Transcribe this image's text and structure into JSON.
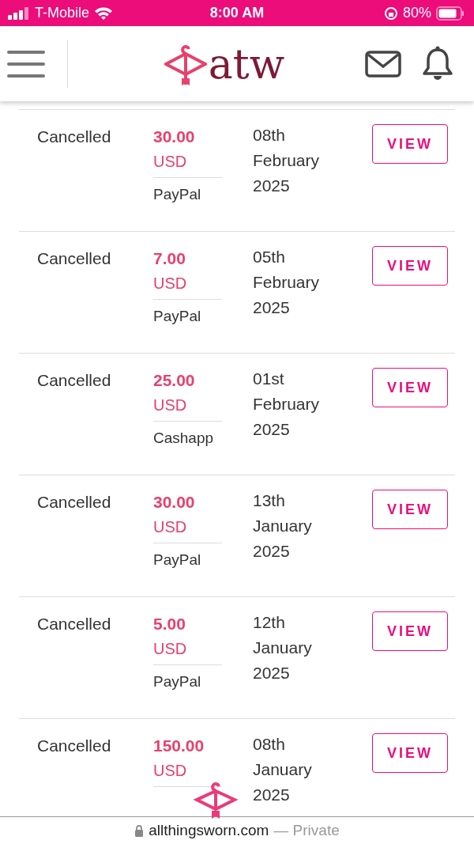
{
  "status_bar": {
    "carrier": "T-Mobile",
    "time": "8:00 AM",
    "battery": "80%"
  },
  "header": {
    "logo_text": "atw"
  },
  "orders": [
    {
      "status": "Cancelled",
      "amount": "30.00",
      "currency": "USD",
      "method": "PayPal",
      "date": [
        "08th",
        "February",
        "2025"
      ],
      "button": "VIEW"
    },
    {
      "status": "Cancelled",
      "amount": "7.00",
      "currency": "USD",
      "method": "PayPal",
      "date": [
        "05th",
        "February",
        "2025"
      ],
      "button": "VIEW"
    },
    {
      "status": "Cancelled",
      "amount": "25.00",
      "currency": "USD",
      "method": "Cashapp",
      "date": [
        "01st",
        "February",
        "2025"
      ],
      "button": "VIEW"
    },
    {
      "status": "Cancelled",
      "amount": "30.00",
      "currency": "USD",
      "method": "PayPal",
      "date": [
        "13th",
        "January",
        "2025"
      ],
      "button": "VIEW"
    },
    {
      "status": "Cancelled",
      "amount": "5.00",
      "currency": "USD",
      "method": "PayPal",
      "date": [
        "12th",
        "January",
        "2025"
      ],
      "button": "VIEW"
    },
    {
      "status": "Cancelled",
      "amount": "150.00",
      "currency": "USD",
      "date": [
        "08th",
        "January",
        "2025"
      ],
      "button": "VIEW"
    }
  ],
  "browser_bar": {
    "url": "allthingsworn.com",
    "mode": "— Private"
  }
}
